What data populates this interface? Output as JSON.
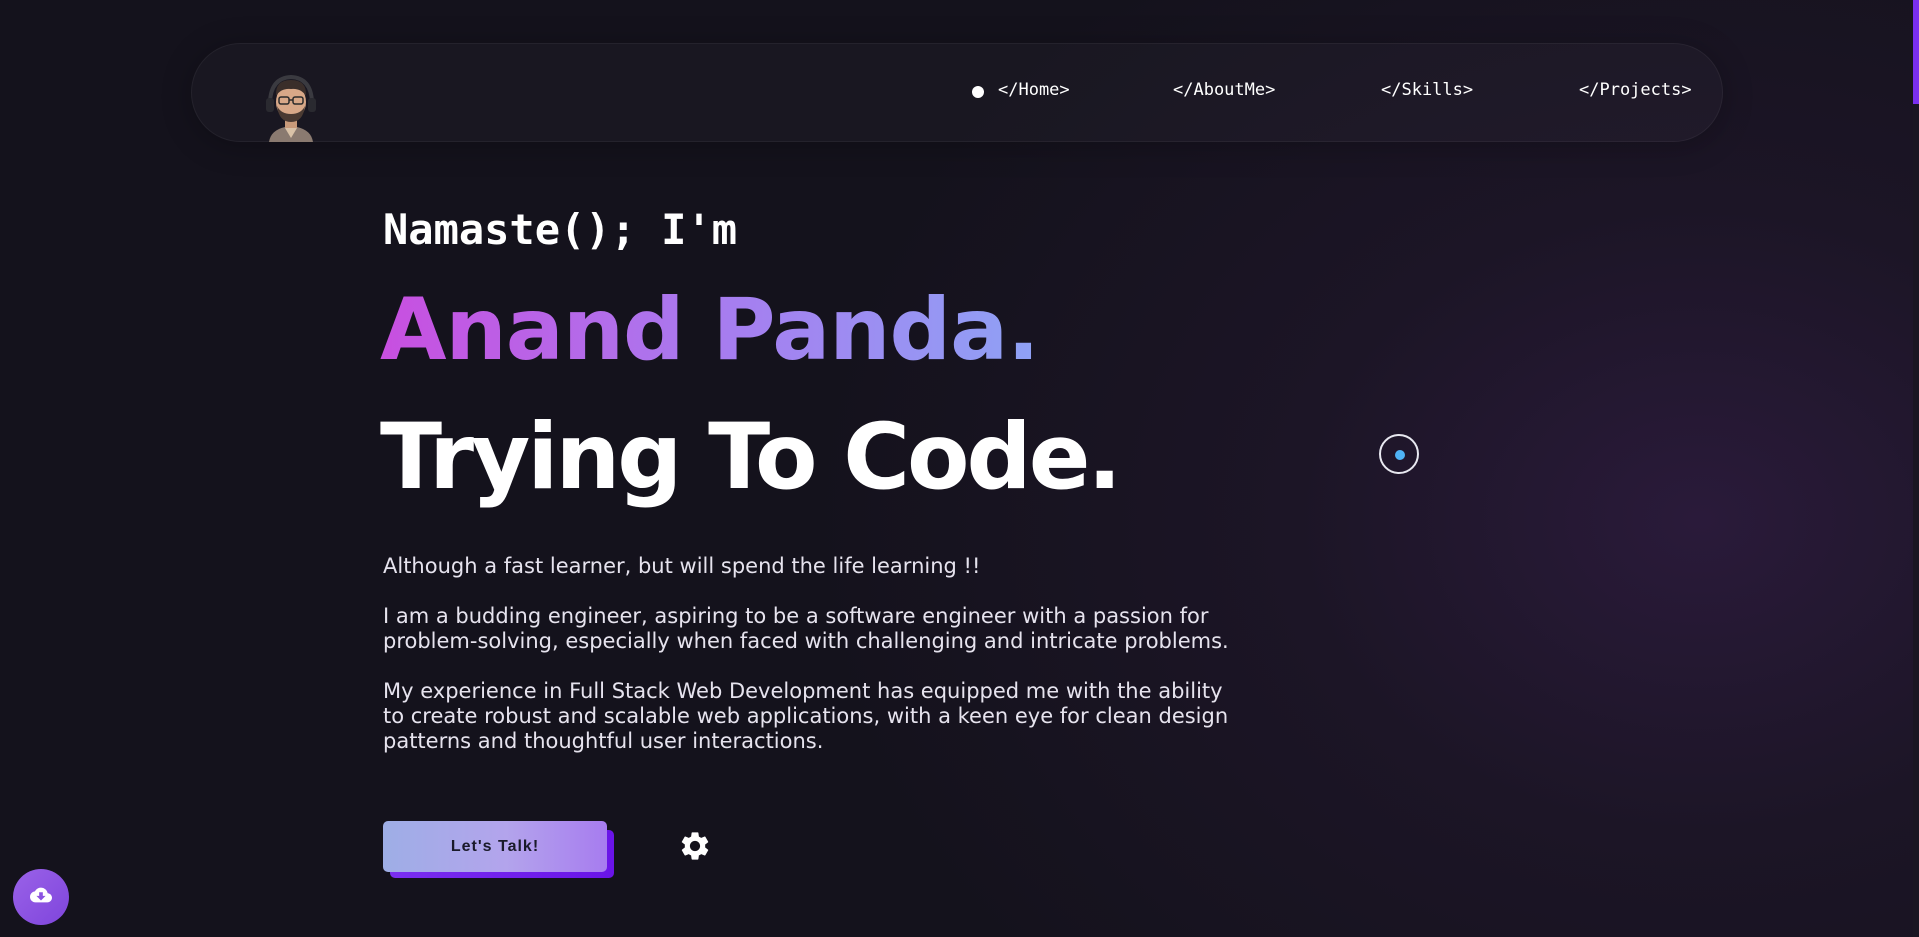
{
  "nav": {
    "links": [
      {
        "label": "</Home>"
      },
      {
        "label": "</AboutMe>"
      },
      {
        "label": "</Skills>"
      },
      {
        "label": "</Projects>"
      }
    ]
  },
  "hero": {
    "greeting": "Namaste(); I'm",
    "name": "Anand Panda.",
    "tagline": "Trying To Code.",
    "paragraphs": [
      "Although a fast learner, but will spend the life learning !!",
      "I am a budding engineer, aspiring to be a software engineer with a passion for problem-solving, especially when faced with challenging and intricate problems.",
      "My experience in Full Stack Web Development has equipped me with the ability to create robust and scalable web applications, with a keen eye for clean design patterns and thoughtful user interactions."
    ],
    "cta_label": "Let's Talk!"
  },
  "icons": {
    "settings": "gear-icon",
    "download": "cloud-download-icon",
    "avatar": "avatar"
  },
  "colors": {
    "accent": "#7a2ff0",
    "background": "#14121c",
    "name_gradient_start": "#c84fe0",
    "name_gradient_end": "#8fa2f5",
    "cursor_dot": "#4fb3f5"
  }
}
